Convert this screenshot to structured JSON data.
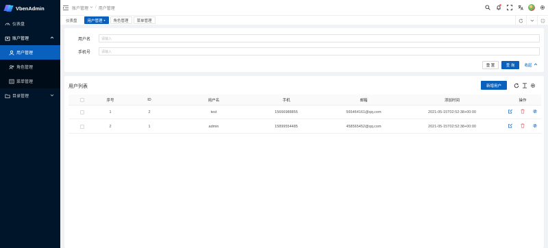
{
  "app": {
    "name": "VbenAdmin"
  },
  "colors": {
    "sidebar_bg": "#001529",
    "primary": "#0960bd",
    "danger": "#ed6f6f"
  },
  "sidebar": {
    "items": [
      {
        "label": "仪表盘",
        "icon": "dashboard-icon"
      },
      {
        "label": "账户管理",
        "icon": "account-icon",
        "expanded": true,
        "children": [
          {
            "label": "用户管理",
            "icon": "user-icon",
            "active": true
          },
          {
            "label": "角色管理",
            "icon": "role-icon"
          },
          {
            "label": "菜单管理",
            "icon": "menu-icon"
          }
        ]
      },
      {
        "label": "目录管理",
        "icon": "folder-icon",
        "expanded": false
      }
    ]
  },
  "header": {
    "breadcrumb": [
      "账户管理",
      "用户管理"
    ]
  },
  "tabs": [
    "仪表盘",
    "用户管理",
    "角色管理",
    "菜单管理"
  ],
  "search": {
    "fields": [
      {
        "label": "用户名",
        "placeholder": "请输入"
      },
      {
        "label": "手机号",
        "placeholder": "请输入"
      }
    ],
    "reset_label": "重 置",
    "query_label": "查 询",
    "collapse_label": "收起"
  },
  "table": {
    "title": "用户列表",
    "add_button": "新增用户",
    "columns": [
      "序号",
      "ID",
      "用户名",
      "手机",
      "邮箱",
      "添加时间",
      "操作"
    ],
    "rows": [
      {
        "index": "1",
        "id": "2",
        "username": "test",
        "phone": "15666988855",
        "email": "565464161@qq.com",
        "created": "2021-05-15T02:52:38+00:00"
      },
      {
        "index": "2",
        "id": "1",
        "username": "admin",
        "phone": "15899554485",
        "email": "458565452@qq.com",
        "created": "2021-05-15T02:52:38+00:00"
      }
    ]
  }
}
